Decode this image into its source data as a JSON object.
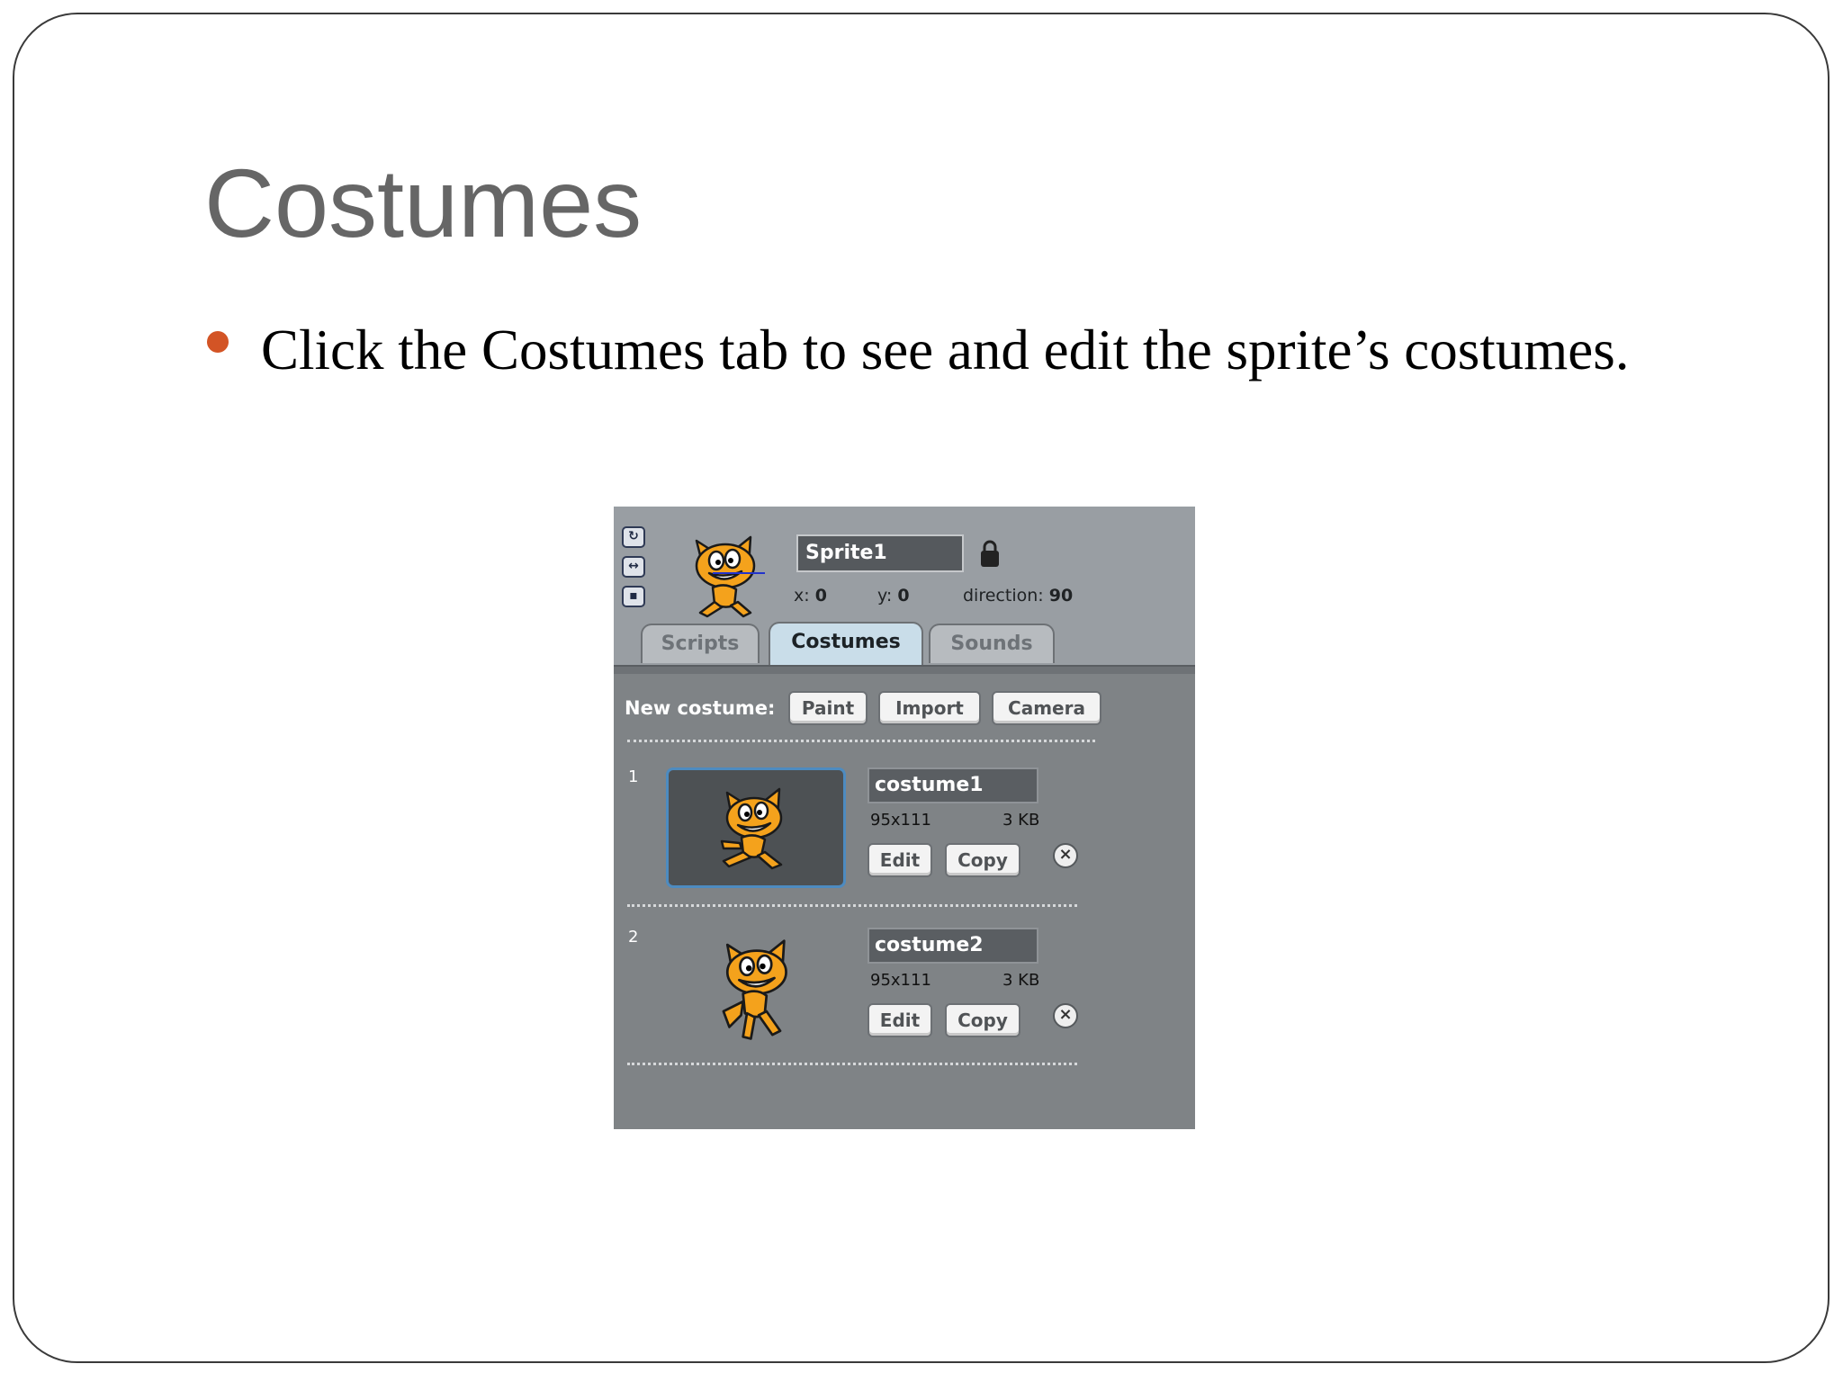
{
  "slide": {
    "title": "Costumes",
    "bullet": "Click the Costumes tab to see and edit the sprite’s costumes."
  },
  "colors": {
    "title": "#666666",
    "bullet": "#d35425",
    "panel": "#7f8386",
    "active_tab": "#c9dde9",
    "thumb_border": "#4d8bc0"
  },
  "sprite": {
    "name": "Sprite1",
    "x_label": "x:",
    "x_value": "0",
    "y_label": "y:",
    "y_value": "0",
    "direction_label": "direction:",
    "direction_value": "90"
  },
  "tabs": [
    {
      "label": "Scripts",
      "active": false
    },
    {
      "label": "Costumes",
      "active": true
    },
    {
      "label": "Sounds",
      "active": false
    }
  ],
  "new_costume": {
    "label": "New costume:",
    "buttons": [
      "Paint",
      "Import",
      "Camera"
    ]
  },
  "costumes": [
    {
      "index": "1",
      "name": "costume1",
      "size": "95x111",
      "kb": "3 KB",
      "edit": "Edit",
      "copy": "Copy",
      "selected": true
    },
    {
      "index": "2",
      "name": "costume2",
      "size": "95x111",
      "kb": "3 KB",
      "edit": "Edit",
      "copy": "Copy",
      "selected": false
    }
  ]
}
